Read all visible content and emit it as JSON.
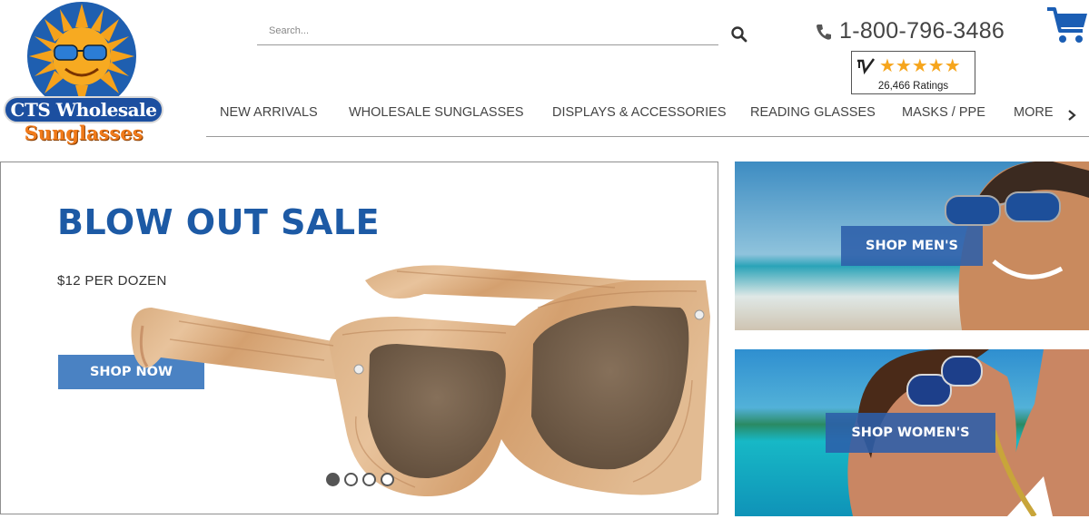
{
  "brand": {
    "logo_line1": "CTS Wholesale",
    "logo_line2": "Sunglasses"
  },
  "search": {
    "placeholder": "Search...",
    "value": ""
  },
  "contact": {
    "phone": "1-800-796-3486"
  },
  "reviews": {
    "stars": "★★★★★",
    "rating_count": "26,466 Ratings"
  },
  "nav": {
    "items": [
      {
        "label": "NEW ARRIVALS"
      },
      {
        "label": "WHOLESALE SUNGLASSES"
      },
      {
        "label": "DISPLAYS & ACCESSORIES"
      },
      {
        "label": "READING GLASSES"
      },
      {
        "label": "MASKS / PPE"
      },
      {
        "label": "MORE"
      }
    ]
  },
  "hero": {
    "title": "BLOW OUT SALE",
    "subtitle": "$12 PER DOZEN",
    "cta": "SHOP NOW",
    "slides_total": 4,
    "active_slide": 1
  },
  "banners": {
    "men_cta": "SHOP MEN'S",
    "women_cta": "SHOP WOMEN'S"
  },
  "colors": {
    "brand_blue": "#1d5aa5",
    "button_blue": "#4a82c3",
    "star_orange": "#f6a51c",
    "cart_blue": "#1b5eb4"
  },
  "icons": {
    "search": "search-icon",
    "phone": "phone-icon",
    "cart": "cart-icon",
    "nav_next": "chevron-right-icon"
  }
}
